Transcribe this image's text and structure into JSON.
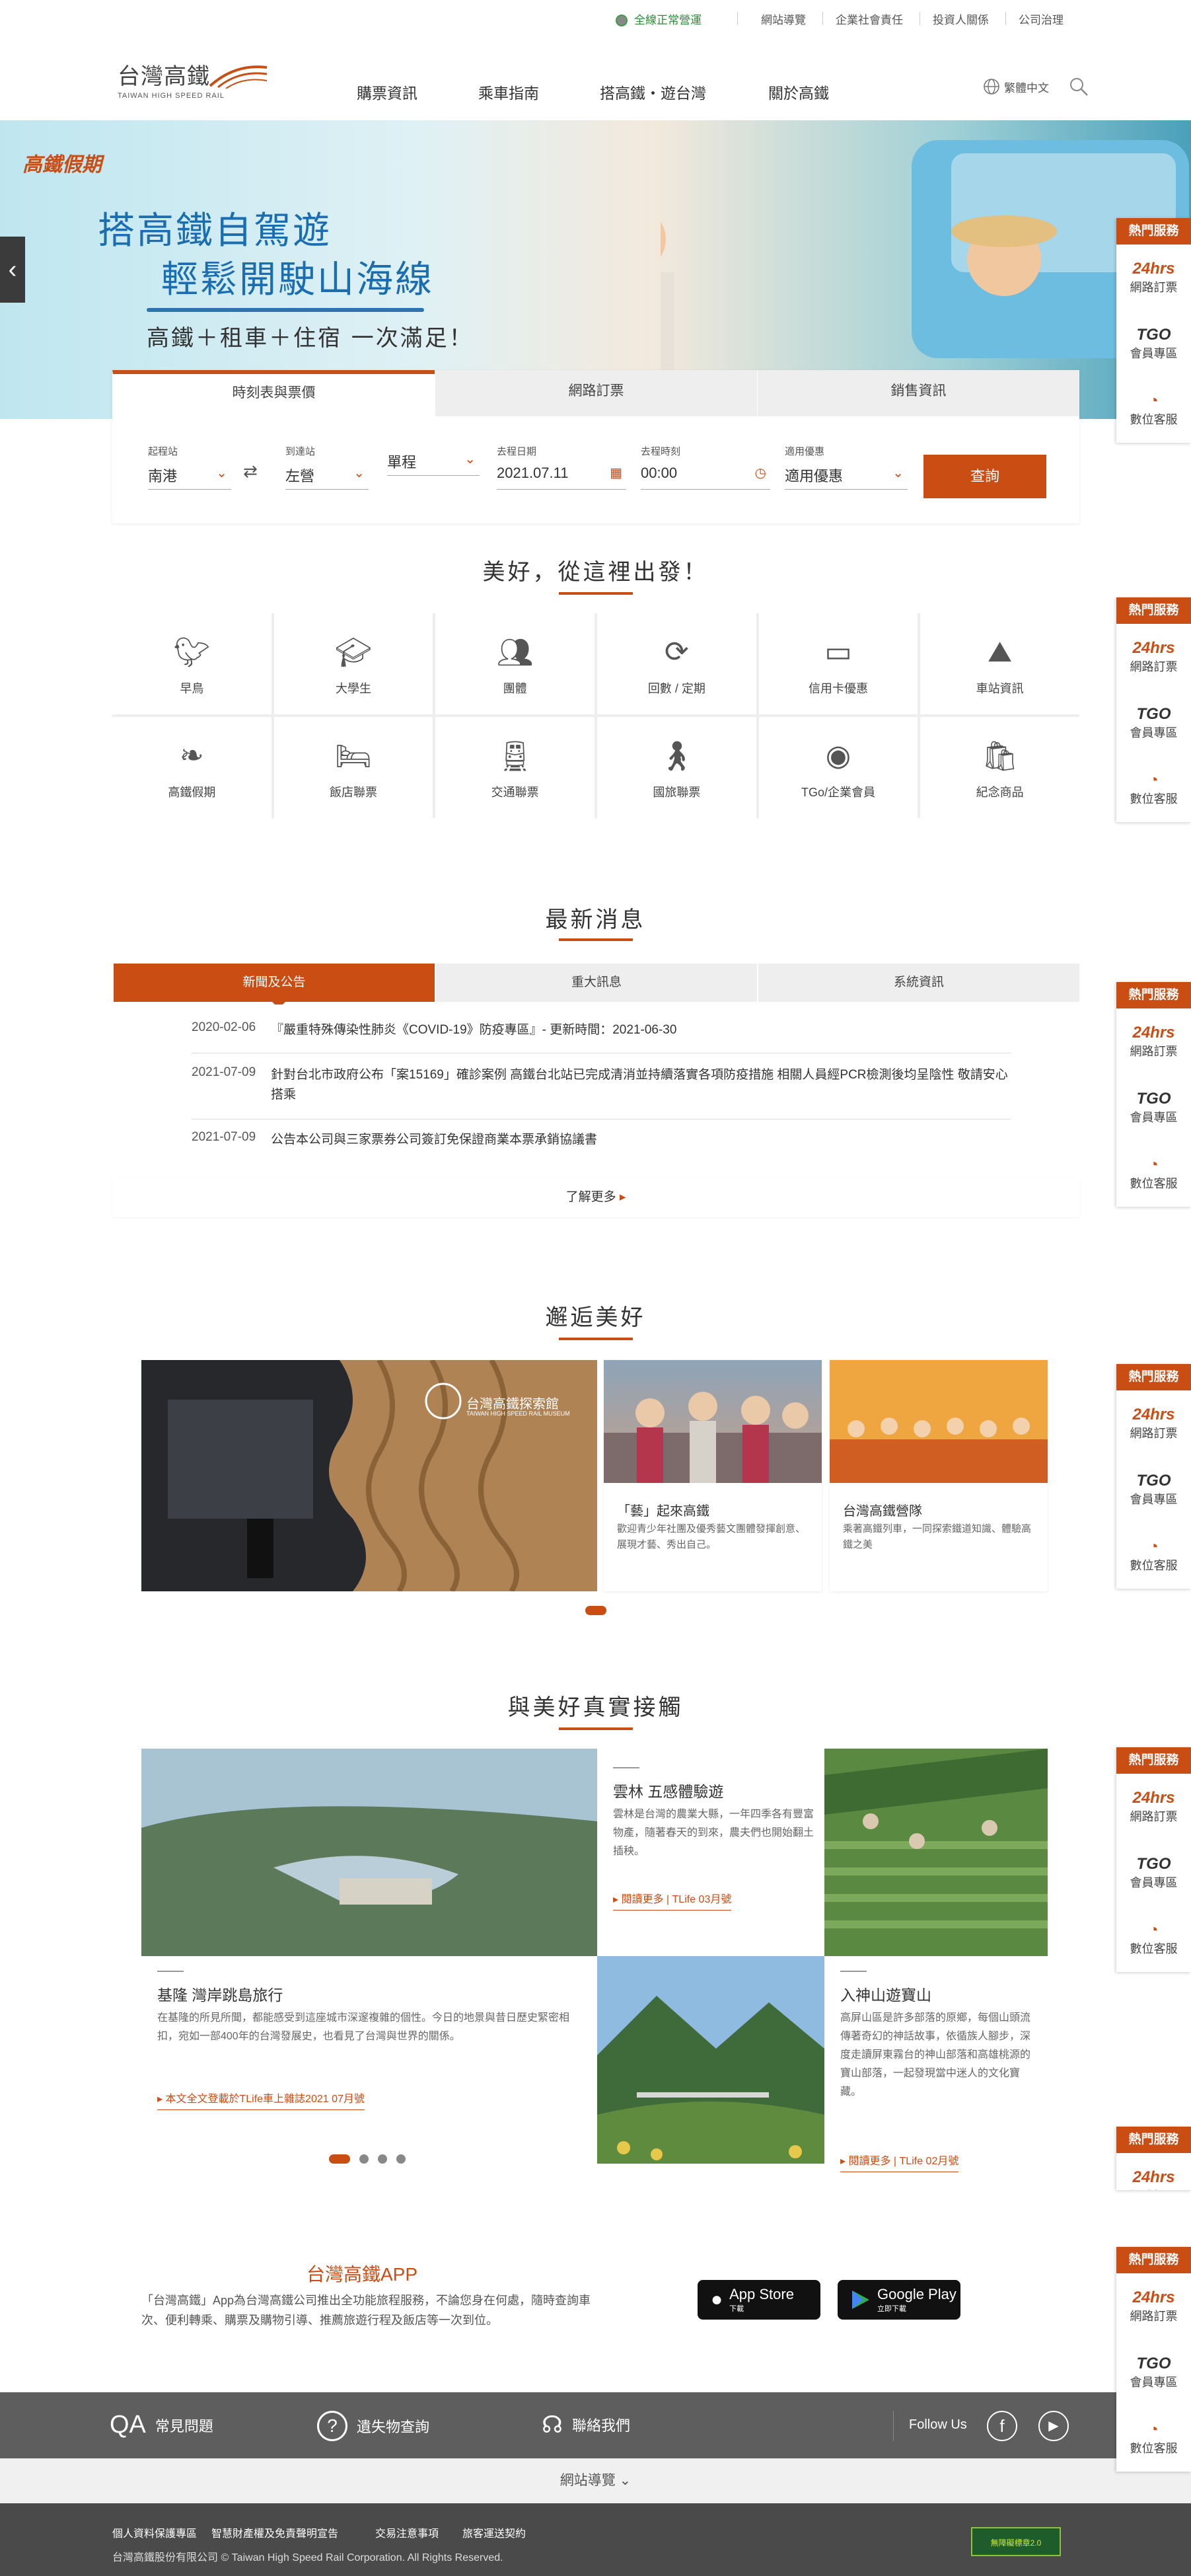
{
  "topbar": {
    "status": "全線正常營運",
    "links": [
      "網站導覽",
      "企業社會責任",
      "投資人關係",
      "公司治理"
    ]
  },
  "logo": {
    "cn": "台灣高鐵",
    "en": "TAIWAN HIGH SPEED RAIL"
  },
  "nav": [
    "購票資訊",
    "乘車指南",
    "搭高鐵・遊台灣",
    "關於高鐵"
  ],
  "lang": "繁體中文",
  "hero": {
    "brand": "高鐵假期",
    "line1": "搭高鐵自駕遊",
    "line2": "輕鬆開駛山海線",
    "line3": "高鐵＋租車＋住宿 一次滿足！"
  },
  "booking": {
    "tabs": [
      "時刻表與票價",
      "網路訂票",
      "銷售資訊"
    ],
    "fields": [
      {
        "label": "起程站",
        "value": "南港"
      },
      {
        "label": "到達站",
        "value": "左營"
      },
      {
        "label": "",
        "value": "單程"
      },
      {
        "label": "去程日期",
        "value": "2021.07.11"
      },
      {
        "label": "去程時刻",
        "value": "00:00"
      },
      {
        "label": "適用優惠",
        "value": "適用優惠"
      }
    ],
    "search": "查詢"
  },
  "section1": {
    "title": "美好，從這裡出發！",
    "items": [
      "早鳥",
      "大學生",
      "團體",
      "回數 / 定期",
      "信用卡優惠",
      "車站資訊",
      "高鐵假期",
      "飯店聯票",
      "交通聯票",
      "國旅聯票",
      "TGo/企業會員",
      "紀念商品"
    ]
  },
  "news": {
    "title": "最新消息",
    "tabs": [
      "新聞及公告",
      "重大訊息",
      "系統資訊"
    ],
    "rows": [
      {
        "date": "2020-02-06",
        "text": "『嚴重特殊傳染性肺炎《COVID-19》防疫專區』- 更新時間：2021-06-30"
      },
      {
        "date": "2021-07-09",
        "text": "針對台北市政府公布「案15169」確診案例 高鐵台北站已完成清消並持續落實各項防疫措施 相關人員經PCR檢測後均呈陰性 敬請安心搭乘"
      },
      {
        "date": "2021-07-09",
        "text": "公告本公司與三家票券公司簽訂免保證商業本票承銷協議書"
      }
    ],
    "more": "了解更多"
  },
  "encounter": {
    "title": "邂逅美好",
    "museum": "台灣高鐵探索館",
    "museum_en": "TAIWAN HIGH SPEED RAIL MUSEUM",
    "cards": [
      {
        "title": "「藝」起來高鐵",
        "text": "歡迎青少年社團及優秀藝文團體發揮創意、展現才藝、秀出自己。"
      },
      {
        "title": "台灣高鐵營隊",
        "text": "乘著高鐵列車，一同探索鐵道知識、體驗高鐵之美"
      }
    ]
  },
  "touch": {
    "title": "與美好真實接觸",
    "a": {
      "title": "雲林 五感體驗遊",
      "text": "雲林是台灣的農業大縣，一年四季各有豐富物產，隨著春天的到來，農夫們也開始翻土插秧。",
      "link": "閱讀更多 | TLife 03月號"
    },
    "b": {
      "title": "基隆 灣岸跳島旅行",
      "text": "在基隆的所見所聞，都能感受到這座城市深邃複雜的個性。今日的地景與昔日歷史緊密相扣，宛如一部400年的台灣發展史，也看見了台灣與世界的關係。",
      "link": "本文全文登載於TLife車上雜誌2021 07月號"
    },
    "c": {
      "title": "入神山遊寶山",
      "text": "高屏山區是許多部落的原鄉，每個山頭流傳著奇幻的神話故事，依循族人腳步，深度走讀屏東霧台的神山部落和高雄桃源的寶山部落，一起發現當中迷人的文化寶藏。",
      "link": "閱讀更多 | TLife 02月號"
    }
  },
  "app": {
    "title": "台灣高鐵APP",
    "text": "「台灣高鐵」App為台灣高鐵公司推出全功能旅程服務，不論您身在何處，隨時查詢車次、便利轉乘、購票及購物引導、推薦旅遊行程及飯店等一次到位。",
    "appstore": "App Store",
    "appstore_sub": "下載",
    "gplay": "Google Play",
    "gplay_sub": "立即下載"
  },
  "footer": {
    "links": [
      "常見問題",
      "遺失物查詢",
      "聯絡我們"
    ],
    "follow": "Follow Us",
    "sitemap": "網站導覽",
    "policies": [
      "個人資料保護專區",
      "智慧財產權及免責聲明宣告",
      "交易注意事項",
      "旅客運送契約"
    ],
    "copyright": "台灣高鐵股份有限公司 © Taiwan High Speed Rail Corporation. All Rights Reserved.",
    "badge": "無障礙標章2.0"
  },
  "side": {
    "header": "熱門服務",
    "items": [
      "網路訂票",
      "會員專區",
      "數位客服"
    ],
    "g1": "24hrs",
    "g2": "TGO"
  },
  "colors": {
    "accent": "#ca4d14"
  }
}
